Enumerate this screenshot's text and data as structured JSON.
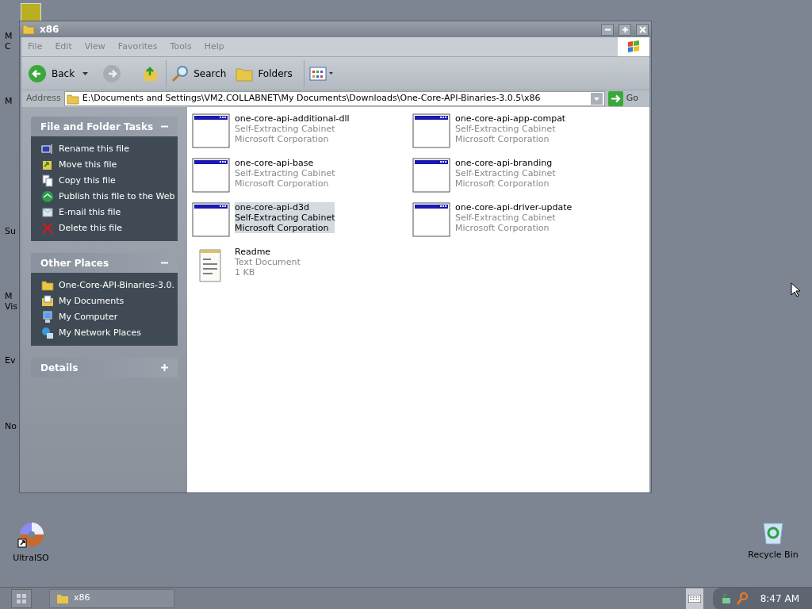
{
  "desktop": {
    "edge_labels": [
      "M",
      "C",
      "M",
      "Su",
      "M",
      "Vis",
      "Ev",
      "No"
    ],
    "icons": [
      {
        "label": "UltraISO",
        "kind": "disc"
      },
      {
        "label": "Recycle Bin",
        "kind": "bin"
      }
    ]
  },
  "window": {
    "title": "x86"
  },
  "menu": [
    {
      "label": "File",
      "disabled": true
    },
    {
      "label": "Edit",
      "disabled": true
    },
    {
      "label": "View",
      "disabled": true
    },
    {
      "label": "Favorites",
      "disabled": true
    },
    {
      "label": "Tools",
      "disabled": true
    },
    {
      "label": "Help",
      "disabled": true
    }
  ],
  "toolbar": {
    "back": "Back",
    "search": "Search",
    "folders": "Folders"
  },
  "address": {
    "label": "Address",
    "value": "E:\\Documents and Settings\\VM2.COLLABNET\\My Documents\\Downloads\\One-Core-API-Binaries-3.0.5\\x86",
    "go": "Go"
  },
  "panels": [
    {
      "title": "File and Folder Tasks",
      "expanded": true,
      "items": [
        {
          "label": "Rename this file"
        },
        {
          "label": "Move this file"
        },
        {
          "label": "Copy this file"
        },
        {
          "label": "Publish this file to the Web"
        },
        {
          "label": "E-mail this file"
        },
        {
          "label": "Delete this file"
        }
      ]
    },
    {
      "title": "Other Places",
      "expanded": true,
      "items": [
        {
          "label": "One-Core-API-Binaries-3.0."
        },
        {
          "label": "My Documents"
        },
        {
          "label": "My Computer"
        },
        {
          "label": "My Network Places"
        }
      ]
    },
    {
      "title": "Details",
      "expanded": false
    }
  ],
  "files": [
    {
      "name": "one-core-api-additional-dll",
      "type": "Self-Extracting Cabinet",
      "detail": "Microsoft Corporation",
      "kind": "app",
      "selected": false
    },
    {
      "name": "one-core-api-app-compat",
      "type": "Self-Extracting Cabinet",
      "detail": "Microsoft Corporation",
      "kind": "app",
      "selected": false
    },
    {
      "name": "one-core-api-base",
      "type": "Self-Extracting Cabinet",
      "detail": "Microsoft Corporation",
      "kind": "app",
      "selected": false
    },
    {
      "name": "one-core-api-branding",
      "type": "Self-Extracting Cabinet",
      "detail": "Microsoft Corporation",
      "kind": "app",
      "selected": false
    },
    {
      "name": "one-core-api-d3d",
      "type": "Self-Extracting Cabinet",
      "detail": "Microsoft Corporation",
      "kind": "app",
      "selected": true
    },
    {
      "name": "one-core-api-driver-update",
      "type": "Self-Extracting Cabinet",
      "detail": "Microsoft Corporation",
      "kind": "app",
      "selected": false
    },
    {
      "name": "Readme",
      "type": "Text Document",
      "detail": "1 KB",
      "kind": "text",
      "selected": false
    }
  ],
  "taskbar": {
    "tasks": [
      {
        "label": "x86"
      }
    ],
    "clock": "8:47 AM"
  }
}
